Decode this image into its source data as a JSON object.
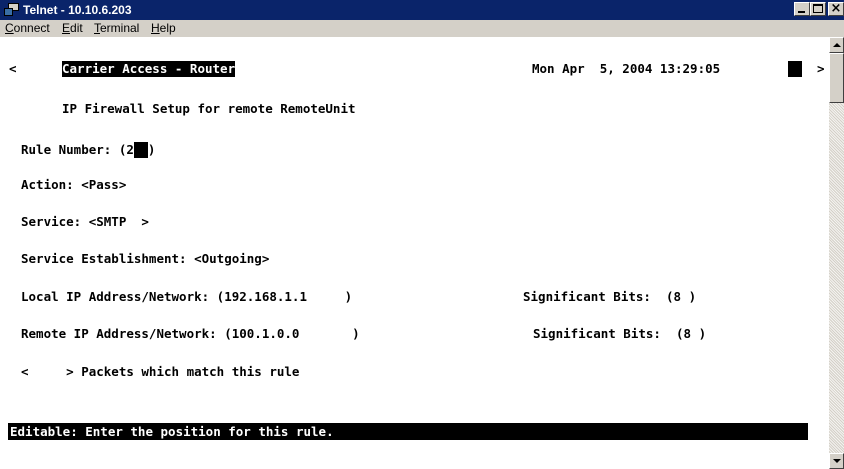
{
  "window": {
    "title": "Telnet - 10.10.6.203"
  },
  "menu": [
    {
      "pre": "",
      "acc": "C",
      "post": "onnect"
    },
    {
      "pre": "",
      "acc": "E",
      "post": "dit"
    },
    {
      "pre": "",
      "acc": "T",
      "post": "erminal"
    },
    {
      "pre": "",
      "acc": "H",
      "post": "elp"
    }
  ],
  "terminal": {
    "nav_left": "<",
    "nav_right": ">",
    "header_title": "Carrier Access - Router",
    "header_datetime": "Mon Apr  5, 2004 13:29:05",
    "screen_title": "IP Firewall Setup for remote RemoteUnit",
    "rule_number_label": "Rule Number: (",
    "rule_number_value": "2",
    "rule_number_close": ")",
    "action": "Action: <Pass>",
    "service": "Service: <SMTP  >",
    "establishment": "Service Establishment: <Outgoing>",
    "local_ip": "Local IP Address/Network: (192.168.1.1     )",
    "local_bits": "Significant Bits:  (8 )",
    "remote_ip": "Remote IP Address/Network: (100.1.0.0       )",
    "remote_bits": "Significant Bits:  (8 )",
    "packets_rule": "<     > Packets which match this rule",
    "status": "Editable: Enter the position for this rule."
  }
}
